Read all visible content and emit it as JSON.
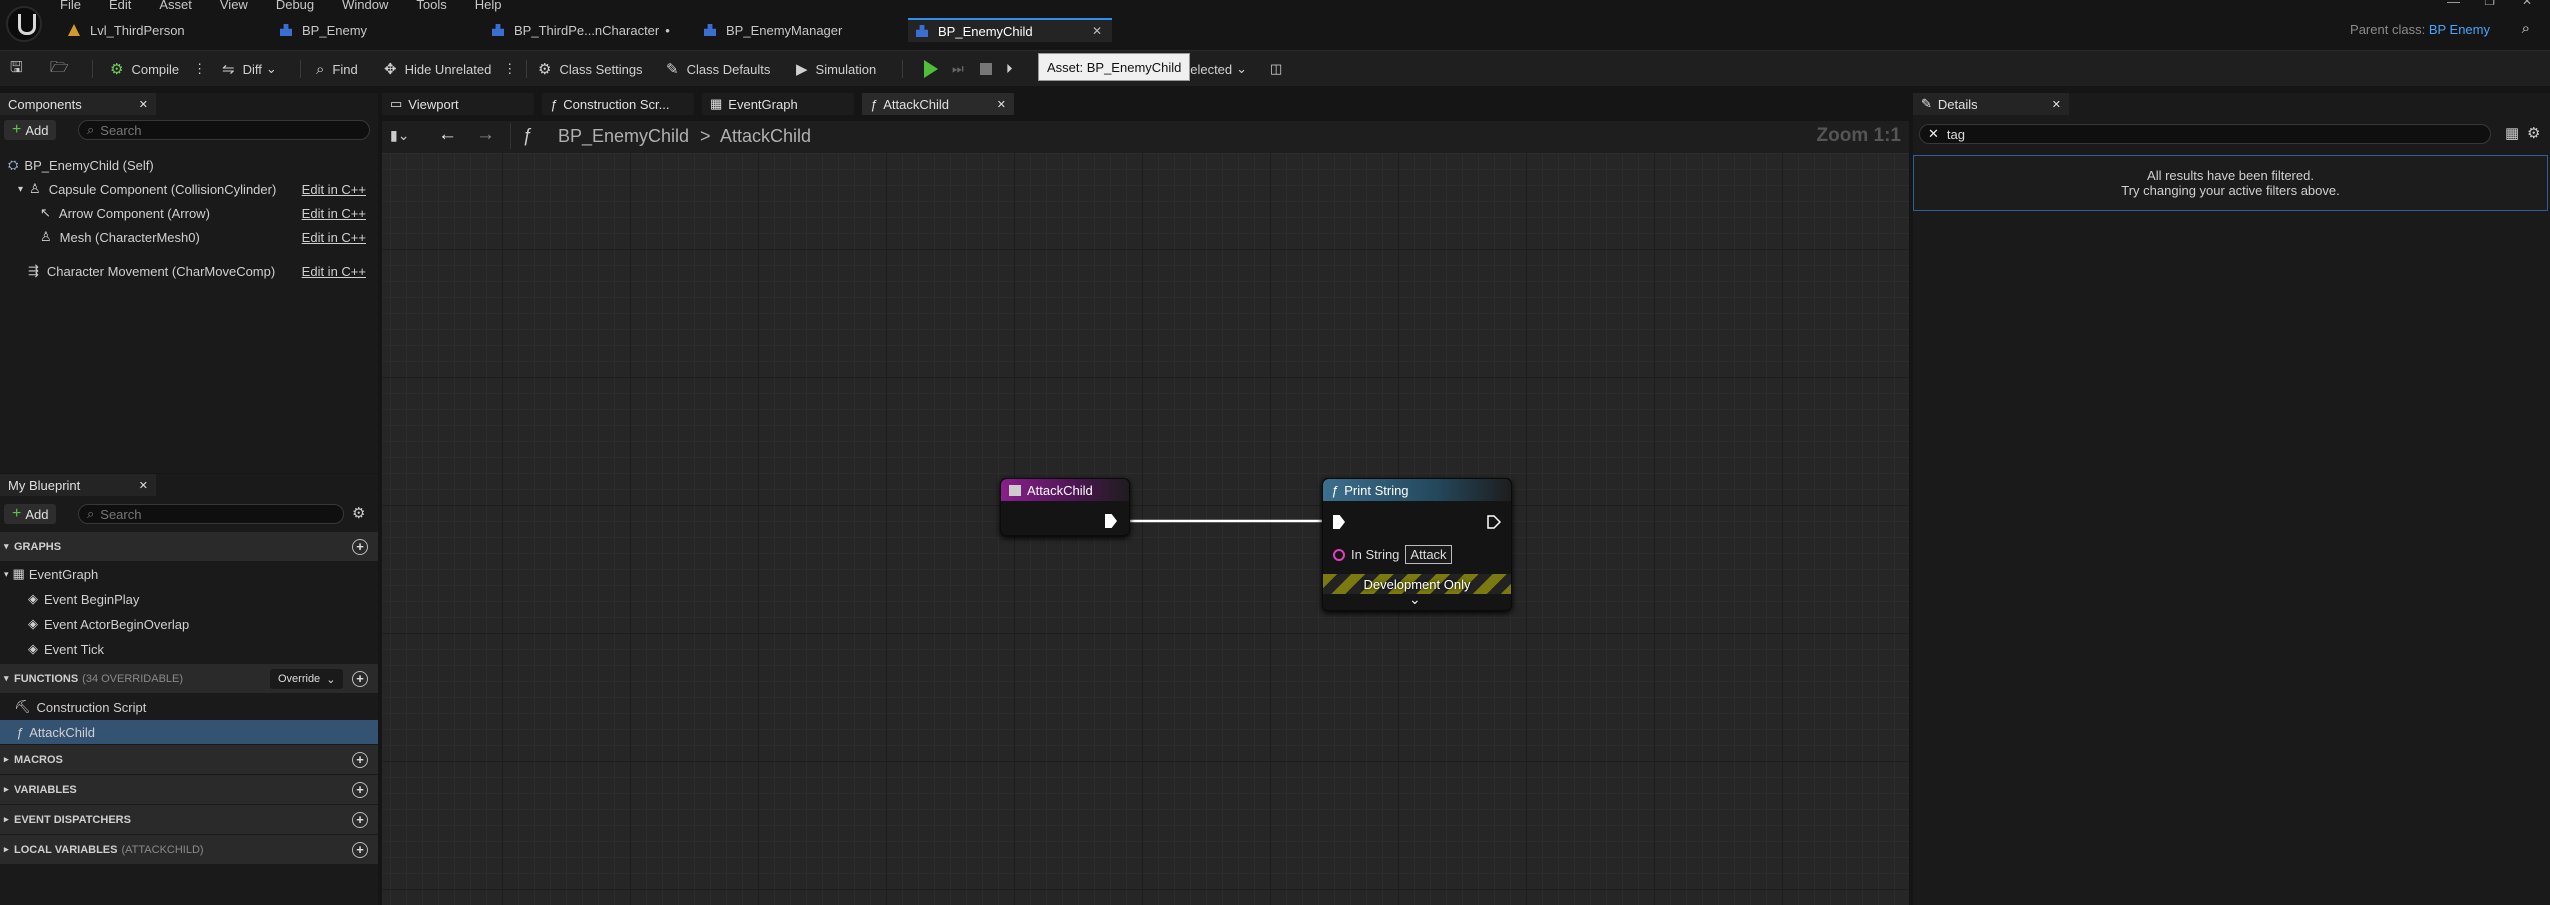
{
  "menu": [
    "File",
    "Edit",
    "Asset",
    "View",
    "Debug",
    "Window",
    "Tools",
    "Help"
  ],
  "doc_tabs": [
    {
      "label": "Lvl_ThirdPerson"
    },
    {
      "label": "BP_Enemy"
    },
    {
      "label": "BP_ThirdPe...nCharacter",
      "modified": "•"
    },
    {
      "label": "BP_EnemyManager"
    },
    {
      "label": "BP_EnemyChild"
    }
  ],
  "parent_class": {
    "label": "Parent class:",
    "value": "BP Enemy"
  },
  "toolbar": {
    "compile": "Compile",
    "diff": "Diff",
    "find": "Find",
    "hide_unrelated": "Hide Unrelated",
    "class_settings": "Class Settings",
    "class_defaults": "Class Defaults",
    "simulation": "Simulation",
    "debug_select": "ct selected",
    "tooltip": "Asset: BP_EnemyChild"
  },
  "components": {
    "tab": "Components",
    "add": "Add",
    "search_placeholder": "Search",
    "self": "BP_EnemyChild (Self)",
    "edit_cpp": "Edit in C++",
    "items": [
      "Capsule Component (CollisionCylinder)",
      "Arrow Component (Arrow)",
      "Mesh (CharacterMesh0)",
      "Character Movement (CharMoveComp)"
    ]
  },
  "my_blueprint": {
    "tab": "My Blueprint",
    "add": "Add",
    "search_placeholder": "Search",
    "graphs_header": "GRAPHS",
    "event_graph": "EventGraph",
    "events": [
      "Event BeginPlay",
      "Event ActorBeginOverlap",
      "Event Tick"
    ],
    "functions_header": "FUNCTIONS",
    "functions_sub": "(34 OVERRIDABLE)",
    "override": "Override",
    "functions": [
      "Construction Script",
      "AttackChild"
    ],
    "macros": "MACROS",
    "variables": "VARIABLES",
    "dispatchers": "EVENT DISPATCHERS",
    "local_vars": "LOCAL VARIABLES",
    "local_vars_sub": "(ATTACKCHILD)"
  },
  "editor_tabs": [
    "Viewport",
    "Construction Scr...",
    "EventGraph",
    "AttackChild"
  ],
  "breadcrumb": {
    "root": "BP_EnemyChild",
    "sep": ">",
    "current": "AttackChild"
  },
  "zoom": "Zoom 1:1",
  "nodes": {
    "entry": {
      "title": "AttackChild"
    },
    "print": {
      "title": "Print String",
      "pin_label": "In String",
      "pin_value": "Attack",
      "dev_only": "Development Only"
    }
  },
  "details": {
    "tab": "Details",
    "search_value": "tag",
    "msg1": "All results have been filtered.",
    "msg2": "Try changing your active filters above."
  }
}
